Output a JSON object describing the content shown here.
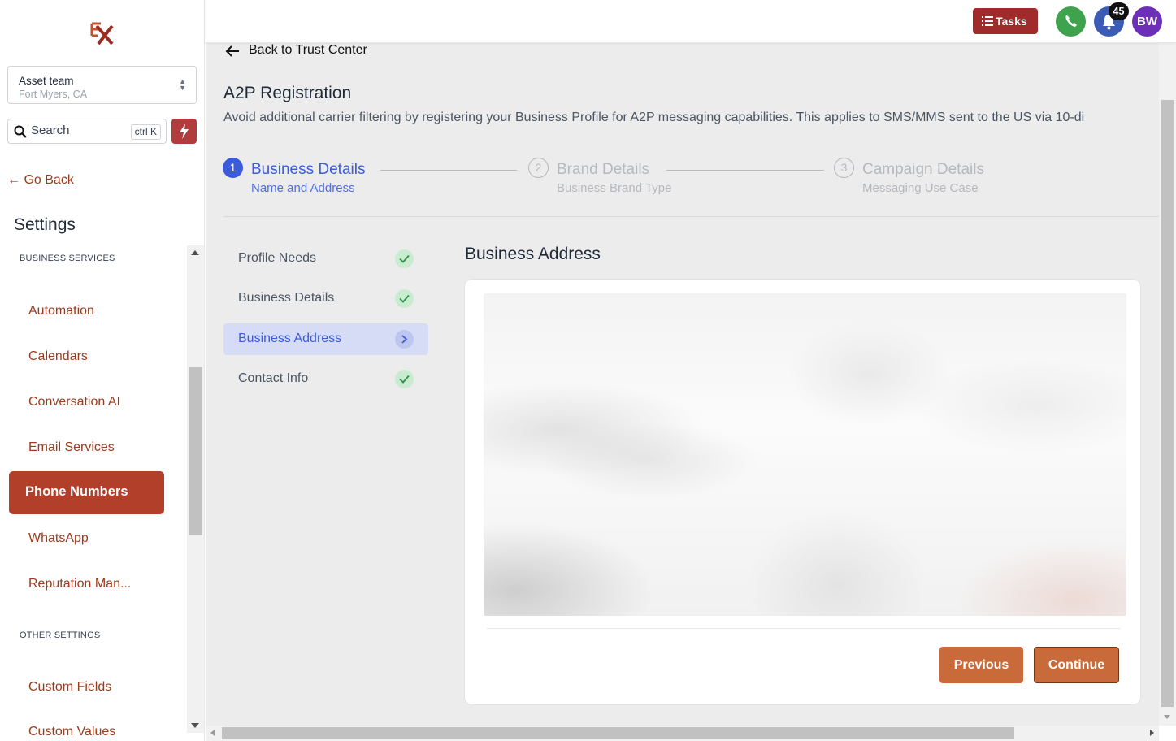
{
  "sidebar": {
    "logo": "EX",
    "account": {
      "name": "Asset team",
      "location": "Fort Myers, CA"
    },
    "search": {
      "label": "Search",
      "shortcut": "ctrl K"
    },
    "go_back": "Go Back",
    "settings_title": "Settings",
    "sections": [
      {
        "label": "BUSINESS SERVICES"
      },
      {
        "label": "OTHER SETTINGS"
      }
    ],
    "items": [
      {
        "label": "Automation"
      },
      {
        "label": "Calendars"
      },
      {
        "label": "Conversation AI"
      },
      {
        "label": "Email Services"
      },
      {
        "label": "Phone Numbers"
      },
      {
        "label": "WhatsApp"
      },
      {
        "label": "Reputation Man..."
      },
      {
        "label": "Custom Fields"
      },
      {
        "label": "Custom Values"
      }
    ],
    "active_item": "Phone Numbers"
  },
  "topbar": {
    "tasks_label": "Tasks",
    "notification_count": "45",
    "avatar_initials": "BW"
  },
  "main": {
    "back_link": "Back to Trust Center",
    "title": "A2P Registration",
    "description": "Avoid additional carrier filtering by registering your Business Profile for A2P messaging capabilities. This applies to SMS/MMS sent to the US via 10-di",
    "steps": [
      {
        "number": "1",
        "title": "Business Details",
        "subtitle": "Name and Address",
        "state": "active"
      },
      {
        "number": "2",
        "title": "Brand Details",
        "subtitle": "Business Brand Type",
        "state": "inactive"
      },
      {
        "number": "3",
        "title": "Campaign Details",
        "subtitle": "Messaging Use Case",
        "state": "inactive"
      }
    ],
    "substeps": [
      {
        "label": "Profile Needs",
        "status": "complete"
      },
      {
        "label": "Business Details",
        "status": "complete"
      },
      {
        "label": "Business Address",
        "status": "current"
      },
      {
        "label": "Contact Info",
        "status": "complete"
      }
    ],
    "section_title": "Business Address",
    "buttons": {
      "previous": "Previous",
      "continue": "Continue"
    }
  },
  "colors": {
    "brand_red": "#b23f2a",
    "step_active": "#3b5bdb",
    "button_orange": "#c86a3a",
    "phone_green": "#3fa34d",
    "avatar_purple": "#6d2fb8"
  }
}
